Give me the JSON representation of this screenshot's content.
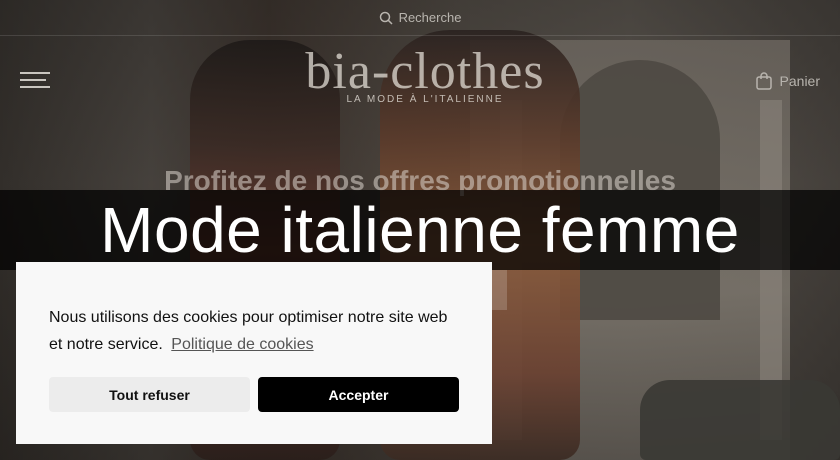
{
  "header": {
    "search_label": "Recherche",
    "logo_text": "bia-clothes",
    "tagline": "LA MODE À L'ITALIENNE",
    "cart_label": "Panier"
  },
  "hero": {
    "promo_text": "Profitez de nos offres promotionnelles"
  },
  "banner": {
    "title": "Mode italienne femme"
  },
  "cookie_dialog": {
    "message": "Nous utilisons des cookies pour optimiser notre site web et notre service.",
    "policy_link": "Politique de cookies",
    "refuse_label": "Tout refuser",
    "accept_label": "Accepter"
  },
  "icons": [
    "search-icon",
    "menu-icon",
    "shopping-bag-icon"
  ]
}
